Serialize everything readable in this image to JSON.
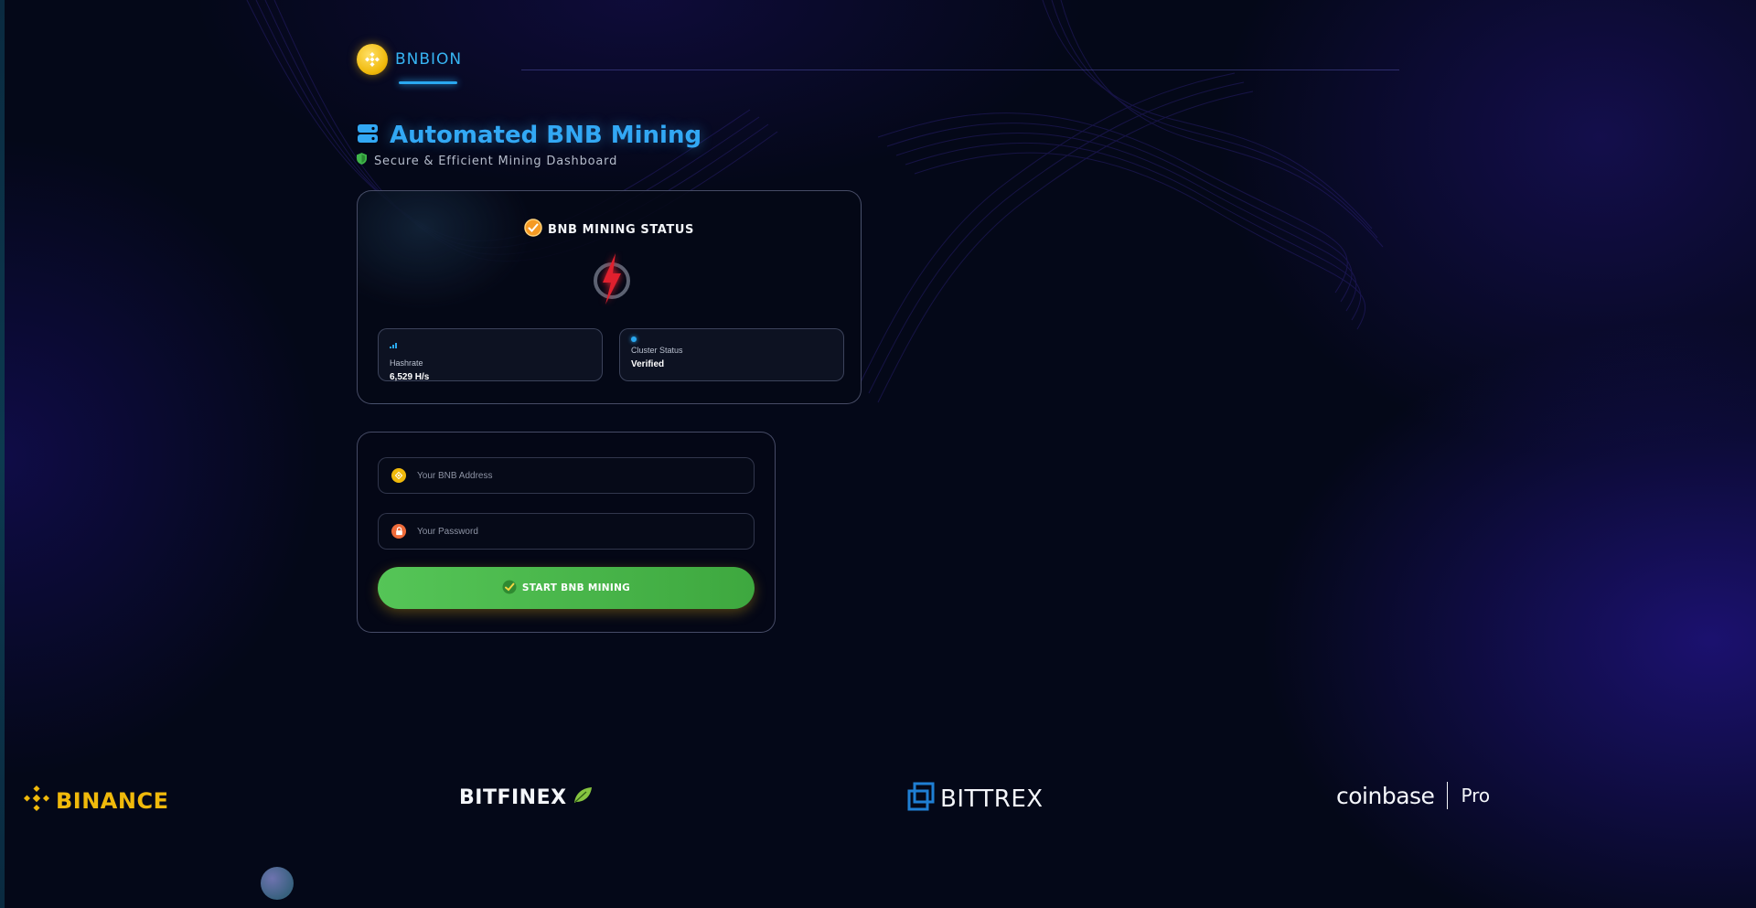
{
  "brand": {
    "name": "BNBION"
  },
  "header": {
    "title": "Automated BNB Mining",
    "subtitle": "Secure & Efficient Mining Dashboard"
  },
  "status_card": {
    "title": "BNB MINING STATUS",
    "stats": [
      {
        "label": "Hashrate",
        "value": "6,529 H/s"
      },
      {
        "label": "Cluster Status",
        "value": "Verified"
      }
    ]
  },
  "form": {
    "address_placeholder": "Your BNB Address",
    "password_placeholder": "Your Password",
    "submit_label": "START BNB MINING"
  },
  "exchanges": {
    "binance": "BINANCE",
    "bitfinex": "BITFINEX",
    "bittrex": "BITTREX",
    "coinbase": "coinbase",
    "coinbase_suffix": "Pro"
  },
  "colors": {
    "accent_blue": "#32a8f4",
    "bnb_yellow": "#f0b90b",
    "button_green": "#4ab84b",
    "power_red": "#e0202e"
  },
  "icons": {
    "brand": "bnb-coin-icon",
    "title": "server-icon",
    "subtitle": "shield-icon",
    "status": "check-badge-icon",
    "status_center": "power-lightning-icon",
    "hashrate": "signal-bars-icon",
    "cluster": "status-dot-icon",
    "address": "bnb-coin-icon",
    "password": "lock-icon",
    "submit": "check-icon"
  }
}
